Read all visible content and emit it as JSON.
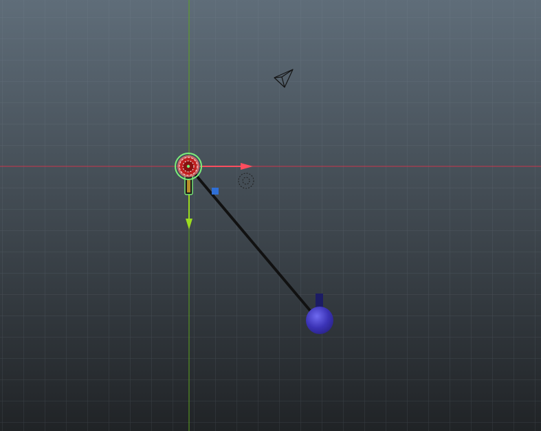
{
  "viewport": {
    "view": "perspective",
    "background_top_color": "#5f6d79",
    "background_bottom_color": "#202326",
    "grid_color": "#8a98a4",
    "axis_x_color": "#c8354a",
    "axis_y_color": "#5ea51e"
  },
  "gizmos": {
    "move_x_arrow_color": "#ff4d5e",
    "move_y_arrow_color": "#9bdc1f",
    "move_z_handle_color": "#2f6fd6",
    "rotate_center_color": "#c02020",
    "selection_outline_color": "#7cf07a"
  },
  "scene_objects": [
    {
      "name": "camera",
      "icon": "camera-icon",
      "selected": false
    },
    {
      "name": "pivot",
      "icon": "pivot-target-icon",
      "selected": true
    },
    {
      "name": "link",
      "icon": "line-segment",
      "color": "#111111"
    },
    {
      "name": "bob",
      "icon": "sphere-icon",
      "color": "#3b33b6",
      "selected": false
    }
  ]
}
